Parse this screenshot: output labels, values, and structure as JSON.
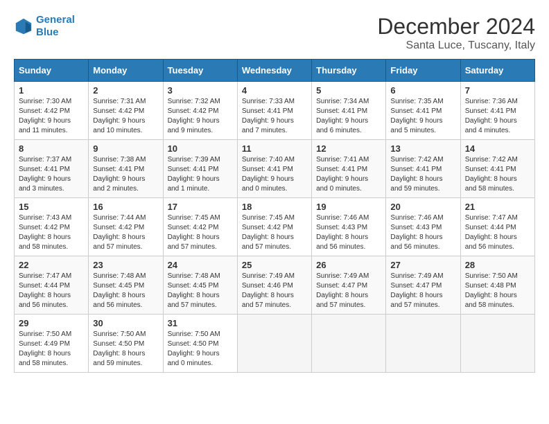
{
  "header": {
    "logo_line1": "General",
    "logo_line2": "Blue",
    "title": "December 2024",
    "subtitle": "Santa Luce, Tuscany, Italy"
  },
  "calendar": {
    "days_of_week": [
      "Sunday",
      "Monday",
      "Tuesday",
      "Wednesday",
      "Thursday",
      "Friday",
      "Saturday"
    ],
    "weeks": [
      [
        {
          "day": "1",
          "sunrise": "7:30 AM",
          "sunset": "4:42 PM",
          "daylight": "9 hours and 11 minutes."
        },
        {
          "day": "2",
          "sunrise": "7:31 AM",
          "sunset": "4:42 PM",
          "daylight": "9 hours and 10 minutes."
        },
        {
          "day": "3",
          "sunrise": "7:32 AM",
          "sunset": "4:42 PM",
          "daylight": "9 hours and 9 minutes."
        },
        {
          "day": "4",
          "sunrise": "7:33 AM",
          "sunset": "4:41 PM",
          "daylight": "9 hours and 7 minutes."
        },
        {
          "day": "5",
          "sunrise": "7:34 AM",
          "sunset": "4:41 PM",
          "daylight": "9 hours and 6 minutes."
        },
        {
          "day": "6",
          "sunrise": "7:35 AM",
          "sunset": "4:41 PM",
          "daylight": "9 hours and 5 minutes."
        },
        {
          "day": "7",
          "sunrise": "7:36 AM",
          "sunset": "4:41 PM",
          "daylight": "9 hours and 4 minutes."
        }
      ],
      [
        {
          "day": "8",
          "sunrise": "7:37 AM",
          "sunset": "4:41 PM",
          "daylight": "9 hours and 3 minutes."
        },
        {
          "day": "9",
          "sunrise": "7:38 AM",
          "sunset": "4:41 PM",
          "daylight": "9 hours and 2 minutes."
        },
        {
          "day": "10",
          "sunrise": "7:39 AM",
          "sunset": "4:41 PM",
          "daylight": "9 hours and 1 minute."
        },
        {
          "day": "11",
          "sunrise": "7:40 AM",
          "sunset": "4:41 PM",
          "daylight": "9 hours and 0 minutes."
        },
        {
          "day": "12",
          "sunrise": "7:41 AM",
          "sunset": "4:41 PM",
          "daylight": "9 hours and 0 minutes."
        },
        {
          "day": "13",
          "sunrise": "7:42 AM",
          "sunset": "4:41 PM",
          "daylight": "8 hours and 59 minutes."
        },
        {
          "day": "14",
          "sunrise": "7:42 AM",
          "sunset": "4:41 PM",
          "daylight": "8 hours and 58 minutes."
        }
      ],
      [
        {
          "day": "15",
          "sunrise": "7:43 AM",
          "sunset": "4:42 PM",
          "daylight": "8 hours and 58 minutes."
        },
        {
          "day": "16",
          "sunrise": "7:44 AM",
          "sunset": "4:42 PM",
          "daylight": "8 hours and 57 minutes."
        },
        {
          "day": "17",
          "sunrise": "7:45 AM",
          "sunset": "4:42 PM",
          "daylight": "8 hours and 57 minutes."
        },
        {
          "day": "18",
          "sunrise": "7:45 AM",
          "sunset": "4:42 PM",
          "daylight": "8 hours and 57 minutes."
        },
        {
          "day": "19",
          "sunrise": "7:46 AM",
          "sunset": "4:43 PM",
          "daylight": "8 hours and 56 minutes."
        },
        {
          "day": "20",
          "sunrise": "7:46 AM",
          "sunset": "4:43 PM",
          "daylight": "8 hours and 56 minutes."
        },
        {
          "day": "21",
          "sunrise": "7:47 AM",
          "sunset": "4:44 PM",
          "daylight": "8 hours and 56 minutes."
        }
      ],
      [
        {
          "day": "22",
          "sunrise": "7:47 AM",
          "sunset": "4:44 PM",
          "daylight": "8 hours and 56 minutes."
        },
        {
          "day": "23",
          "sunrise": "7:48 AM",
          "sunset": "4:45 PM",
          "daylight": "8 hours and 56 minutes."
        },
        {
          "day": "24",
          "sunrise": "7:48 AM",
          "sunset": "4:45 PM",
          "daylight": "8 hours and 57 minutes."
        },
        {
          "day": "25",
          "sunrise": "7:49 AM",
          "sunset": "4:46 PM",
          "daylight": "8 hours and 57 minutes."
        },
        {
          "day": "26",
          "sunrise": "7:49 AM",
          "sunset": "4:47 PM",
          "daylight": "8 hours and 57 minutes."
        },
        {
          "day": "27",
          "sunrise": "7:49 AM",
          "sunset": "4:47 PM",
          "daylight": "8 hours and 57 minutes."
        },
        {
          "day": "28",
          "sunrise": "7:50 AM",
          "sunset": "4:48 PM",
          "daylight": "8 hours and 58 minutes."
        }
      ],
      [
        {
          "day": "29",
          "sunrise": "7:50 AM",
          "sunset": "4:49 PM",
          "daylight": "8 hours and 58 minutes."
        },
        {
          "day": "30",
          "sunrise": "7:50 AM",
          "sunset": "4:50 PM",
          "daylight": "8 hours and 59 minutes."
        },
        {
          "day": "31",
          "sunrise": "7:50 AM",
          "sunset": "4:50 PM",
          "daylight": "9 hours and 0 minutes."
        },
        null,
        null,
        null,
        null
      ]
    ]
  }
}
